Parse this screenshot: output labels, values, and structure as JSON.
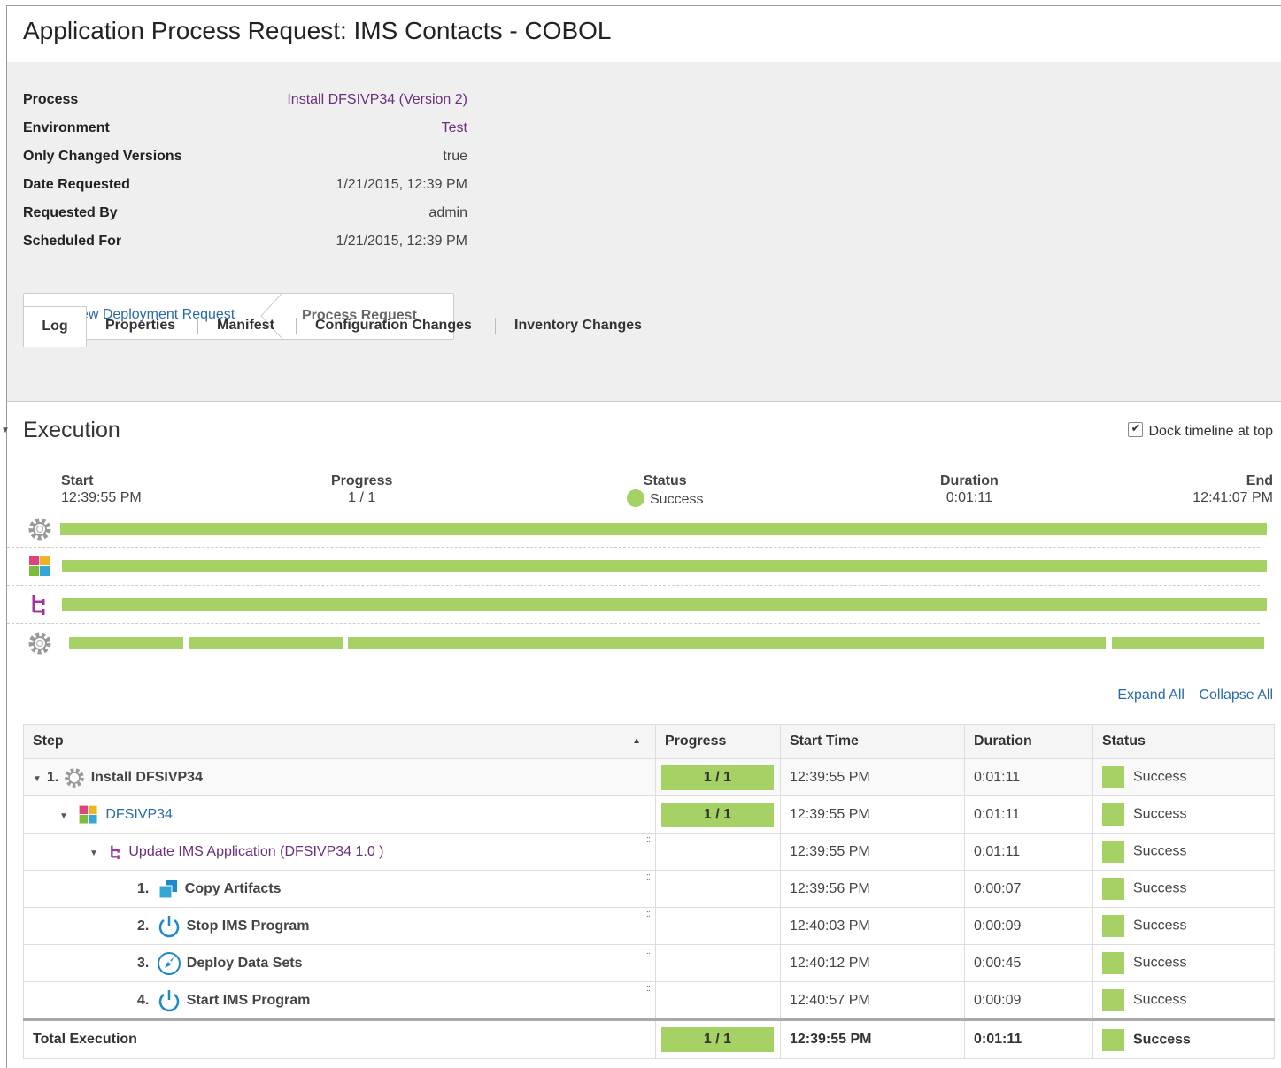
{
  "page": {
    "title": "Application Process Request: IMS Contacts - COBOL"
  },
  "info": [
    {
      "label": "Process",
      "value": "Install DFSIVP34 (Version 2)"
    },
    {
      "label": "Environment",
      "value": "Test"
    },
    {
      "label": "Only Changed Versions",
      "value": "true"
    },
    {
      "label": "Date Requested",
      "value": "1/21/2015, 12:39 PM"
    },
    {
      "label": "Requested By",
      "value": "admin"
    },
    {
      "label": "Scheduled For",
      "value": "1/21/2015, 12:39 PM"
    }
  ],
  "breadcrumb": {
    "deployment": "View Deployment Request",
    "current": "Process Request"
  },
  "tabs": [
    "Log",
    "Properties",
    "Manifest",
    "Configuration Changes",
    "Inventory Changes"
  ],
  "execution": {
    "title": "Execution",
    "dock_label": "Dock timeline at top",
    "start_label": "Start",
    "start_value": "12:39:55 PM",
    "progress_label": "Progress",
    "progress_value": "1 / 1",
    "status_label": "Status",
    "status_value": "Success",
    "duration_label": "Duration",
    "duration_value": "0:01:11",
    "end_label": "End",
    "end_value": "12:41:07 PM"
  },
  "links": {
    "expand": "Expand All",
    "collapse": "Collapse All"
  },
  "table": {
    "headers": [
      "Step",
      "Progress",
      "Start Time",
      "Duration",
      "Status"
    ],
    "rows": [
      {
        "num": "1.",
        "name": "Install DFSIVP34",
        "progress": "1 / 1",
        "start": "12:39:55 PM",
        "duration": "0:01:11",
        "status": "Success"
      },
      {
        "num": "",
        "name": "DFSIVP34",
        "progress": "1 / 1",
        "start": "12:39:55 PM",
        "duration": "0:01:11",
        "status": "Success"
      },
      {
        "num": "",
        "name": "Update IMS Application (DFSIVP34 1.0 )",
        "progress": "",
        "start": "12:39:55 PM",
        "duration": "0:01:11",
        "status": "Success"
      },
      {
        "num": "1.",
        "name": "Copy Artifacts",
        "progress": "",
        "start": "12:39:56 PM",
        "duration": "0:00:07",
        "status": "Success"
      },
      {
        "num": "2.",
        "name": "Stop IMS Program",
        "progress": "",
        "start": "12:40:03 PM",
        "duration": "0:00:09",
        "status": "Success"
      },
      {
        "num": "3.",
        "name": "Deploy Data Sets",
        "progress": "",
        "start": "12:40:12 PM",
        "duration": "0:00:45",
        "status": "Success"
      },
      {
        "num": "4.",
        "name": "Start IMS Program",
        "progress": "",
        "start": "12:40:57 PM",
        "duration": "0:00:09",
        "status": "Success"
      }
    ],
    "total": {
      "label": "Total Execution",
      "progress": "1 / 1",
      "start": "12:39:55 PM",
      "duration": "0:01:11",
      "status": "Success"
    }
  },
  "colors": {
    "success": "#a6d164",
    "link": "#2a6aa8",
    "process": "#6b2f7d"
  }
}
